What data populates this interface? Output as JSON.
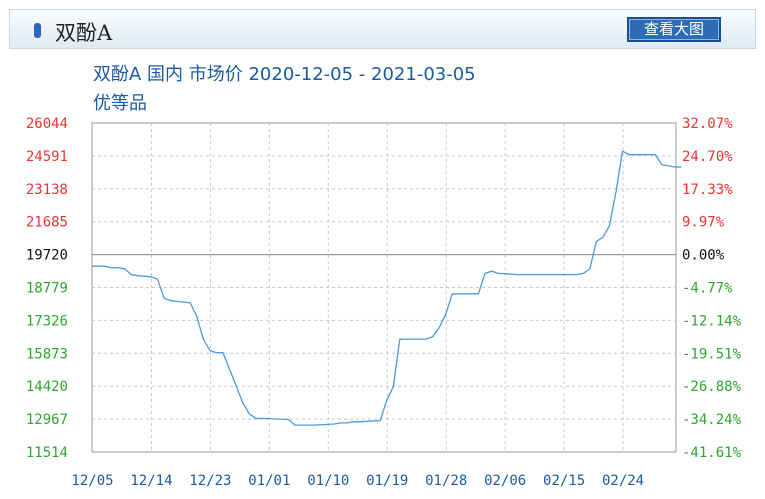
{
  "header": {
    "title": "双酚A",
    "view_button": "查看大图"
  },
  "chart_data": {
    "type": "line",
    "title": "双酚A 国内 市场价 2020-12-05 - 2021-03-05",
    "subtitle": "优等品",
    "x_ticks": [
      "12/05",
      "12/14",
      "12/23",
      "01/01",
      "01/10",
      "01/19",
      "01/28",
      "02/06",
      "02/15",
      "02/24"
    ],
    "y_left_ticks": [
      "26044",
      "24591",
      "23138",
      "21685",
      "19720",
      "18779",
      "17326",
      "15873",
      "14420",
      "12967",
      "11514"
    ],
    "y_right_ticks": [
      "32.07%",
      "24.70%",
      "17.33%",
      "9.97%",
      "0.00%",
      "-4.77%",
      "-12.14%",
      "-19.51%",
      "-26.88%",
      "-34.24%",
      "-41.61%"
    ],
    "ylim": [
      11514,
      26044
    ],
    "baseline": 19720,
    "colors": {
      "line": "#4a9ad8",
      "positive": "#ee3333",
      "negative": "#2fa52f",
      "neutral": "#111111",
      "grid": "#c8c8c8",
      "x_tick": "#1b5a9c"
    },
    "series": [
      {
        "x": [
          "2020-12-05",
          "2020-12-07",
          "2020-12-08",
          "2020-12-09",
          "2020-12-10",
          "2020-12-11",
          "2020-12-12",
          "2020-12-14",
          "2020-12-15",
          "2020-12-16",
          "2020-12-17",
          "2020-12-20",
          "2020-12-21",
          "2020-12-22",
          "2020-12-23",
          "2020-12-24",
          "2020-12-25",
          "2020-12-28",
          "2020-12-29",
          "2020-12-30",
          "2020-12-31",
          "2021-01-04",
          "2021-01-05",
          "2021-01-06",
          "2021-01-07",
          "2021-01-08",
          "2021-01-11",
          "2021-01-12",
          "2021-01-13",
          "2021-01-14",
          "2021-01-15",
          "2021-01-18",
          "2021-01-19",
          "2021-01-20",
          "2021-01-21",
          "2021-01-22",
          "2021-01-25",
          "2021-01-26",
          "2021-01-27",
          "2021-01-28",
          "2021-01-29",
          "2021-02-01",
          "2021-02-02",
          "2021-02-03",
          "2021-02-04",
          "2021-02-05",
          "2021-02-08",
          "2021-02-10",
          "2021-02-17",
          "2021-02-18",
          "2021-02-19",
          "2021-02-20",
          "2021-02-21",
          "2021-02-22",
          "2021-02-23",
          "2021-02-24",
          "2021-02-25",
          "2021-02-26",
          "2021-03-01",
          "2021-03-02",
          "2021-03-03",
          "2021-03-04",
          "2021-03-05"
        ],
        "y": [
          19720,
          19720,
          19650,
          19650,
          19600,
          19350,
          19300,
          19250,
          19150,
          18300,
          18200,
          18100,
          17500,
          16500,
          16000,
          15900,
          15900,
          13700,
          13200,
          13000,
          13000,
          12950,
          12700,
          12700,
          12700,
          12700,
          12750,
          12800,
          12800,
          12850,
          12850,
          12900,
          13800,
          14400,
          16500,
          16500,
          16500,
          16600,
          17000,
          17600,
          18500,
          18500,
          18500,
          19400,
          19500,
          19400,
          19350,
          19350,
          19350,
          19400,
          19600,
          20800,
          21000,
          21500,
          23000,
          24800,
          24650,
          24650,
          24650,
          24200,
          24150,
          24100,
          24100
        ]
      }
    ]
  }
}
